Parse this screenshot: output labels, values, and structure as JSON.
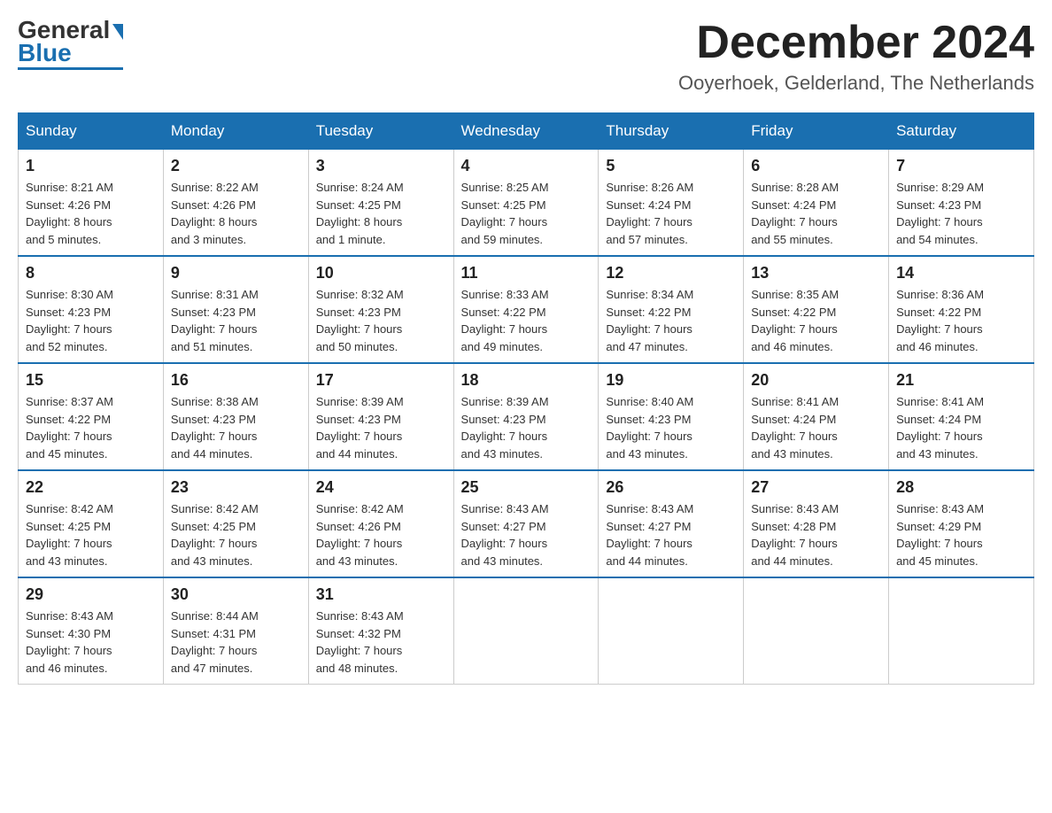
{
  "header": {
    "logo_text_black": "General",
    "logo_text_blue": "Blue",
    "month_title": "December 2024",
    "location": "Ooyerhoek, Gelderland, The Netherlands"
  },
  "days_of_week": [
    "Sunday",
    "Monday",
    "Tuesday",
    "Wednesday",
    "Thursday",
    "Friday",
    "Saturday"
  ],
  "weeks": [
    [
      {
        "day": "1",
        "sunrise": "Sunrise: 8:21 AM",
        "sunset": "Sunset: 4:26 PM",
        "daylight": "Daylight: 8 hours and 5 minutes."
      },
      {
        "day": "2",
        "sunrise": "Sunrise: 8:22 AM",
        "sunset": "Sunset: 4:26 PM",
        "daylight": "Daylight: 8 hours and 3 minutes."
      },
      {
        "day": "3",
        "sunrise": "Sunrise: 8:24 AM",
        "sunset": "Sunset: 4:25 PM",
        "daylight": "Daylight: 8 hours and 1 minute."
      },
      {
        "day": "4",
        "sunrise": "Sunrise: 8:25 AM",
        "sunset": "Sunset: 4:25 PM",
        "daylight": "Daylight: 7 hours and 59 minutes."
      },
      {
        "day": "5",
        "sunrise": "Sunrise: 8:26 AM",
        "sunset": "Sunset: 4:24 PM",
        "daylight": "Daylight: 7 hours and 57 minutes."
      },
      {
        "day": "6",
        "sunrise": "Sunrise: 8:28 AM",
        "sunset": "Sunset: 4:24 PM",
        "daylight": "Daylight: 7 hours and 55 minutes."
      },
      {
        "day": "7",
        "sunrise": "Sunrise: 8:29 AM",
        "sunset": "Sunset: 4:23 PM",
        "daylight": "Daylight: 7 hours and 54 minutes."
      }
    ],
    [
      {
        "day": "8",
        "sunrise": "Sunrise: 8:30 AM",
        "sunset": "Sunset: 4:23 PM",
        "daylight": "Daylight: 7 hours and 52 minutes."
      },
      {
        "day": "9",
        "sunrise": "Sunrise: 8:31 AM",
        "sunset": "Sunset: 4:23 PM",
        "daylight": "Daylight: 7 hours and 51 minutes."
      },
      {
        "day": "10",
        "sunrise": "Sunrise: 8:32 AM",
        "sunset": "Sunset: 4:23 PM",
        "daylight": "Daylight: 7 hours and 50 minutes."
      },
      {
        "day": "11",
        "sunrise": "Sunrise: 8:33 AM",
        "sunset": "Sunset: 4:22 PM",
        "daylight": "Daylight: 7 hours and 49 minutes."
      },
      {
        "day": "12",
        "sunrise": "Sunrise: 8:34 AM",
        "sunset": "Sunset: 4:22 PM",
        "daylight": "Daylight: 7 hours and 47 minutes."
      },
      {
        "day": "13",
        "sunrise": "Sunrise: 8:35 AM",
        "sunset": "Sunset: 4:22 PM",
        "daylight": "Daylight: 7 hours and 46 minutes."
      },
      {
        "day": "14",
        "sunrise": "Sunrise: 8:36 AM",
        "sunset": "Sunset: 4:22 PM",
        "daylight": "Daylight: 7 hours and 46 minutes."
      }
    ],
    [
      {
        "day": "15",
        "sunrise": "Sunrise: 8:37 AM",
        "sunset": "Sunset: 4:22 PM",
        "daylight": "Daylight: 7 hours and 45 minutes."
      },
      {
        "day": "16",
        "sunrise": "Sunrise: 8:38 AM",
        "sunset": "Sunset: 4:23 PM",
        "daylight": "Daylight: 7 hours and 44 minutes."
      },
      {
        "day": "17",
        "sunrise": "Sunrise: 8:39 AM",
        "sunset": "Sunset: 4:23 PM",
        "daylight": "Daylight: 7 hours and 44 minutes."
      },
      {
        "day": "18",
        "sunrise": "Sunrise: 8:39 AM",
        "sunset": "Sunset: 4:23 PM",
        "daylight": "Daylight: 7 hours and 43 minutes."
      },
      {
        "day": "19",
        "sunrise": "Sunrise: 8:40 AM",
        "sunset": "Sunset: 4:23 PM",
        "daylight": "Daylight: 7 hours and 43 minutes."
      },
      {
        "day": "20",
        "sunrise": "Sunrise: 8:41 AM",
        "sunset": "Sunset: 4:24 PM",
        "daylight": "Daylight: 7 hours and 43 minutes."
      },
      {
        "day": "21",
        "sunrise": "Sunrise: 8:41 AM",
        "sunset": "Sunset: 4:24 PM",
        "daylight": "Daylight: 7 hours and 43 minutes."
      }
    ],
    [
      {
        "day": "22",
        "sunrise": "Sunrise: 8:42 AM",
        "sunset": "Sunset: 4:25 PM",
        "daylight": "Daylight: 7 hours and 43 minutes."
      },
      {
        "day": "23",
        "sunrise": "Sunrise: 8:42 AM",
        "sunset": "Sunset: 4:25 PM",
        "daylight": "Daylight: 7 hours and 43 minutes."
      },
      {
        "day": "24",
        "sunrise": "Sunrise: 8:42 AM",
        "sunset": "Sunset: 4:26 PM",
        "daylight": "Daylight: 7 hours and 43 minutes."
      },
      {
        "day": "25",
        "sunrise": "Sunrise: 8:43 AM",
        "sunset": "Sunset: 4:27 PM",
        "daylight": "Daylight: 7 hours and 43 minutes."
      },
      {
        "day": "26",
        "sunrise": "Sunrise: 8:43 AM",
        "sunset": "Sunset: 4:27 PM",
        "daylight": "Daylight: 7 hours and 44 minutes."
      },
      {
        "day": "27",
        "sunrise": "Sunrise: 8:43 AM",
        "sunset": "Sunset: 4:28 PM",
        "daylight": "Daylight: 7 hours and 44 minutes."
      },
      {
        "day": "28",
        "sunrise": "Sunrise: 8:43 AM",
        "sunset": "Sunset: 4:29 PM",
        "daylight": "Daylight: 7 hours and 45 minutes."
      }
    ],
    [
      {
        "day": "29",
        "sunrise": "Sunrise: 8:43 AM",
        "sunset": "Sunset: 4:30 PM",
        "daylight": "Daylight: 7 hours and 46 minutes."
      },
      {
        "day": "30",
        "sunrise": "Sunrise: 8:44 AM",
        "sunset": "Sunset: 4:31 PM",
        "daylight": "Daylight: 7 hours and 47 minutes."
      },
      {
        "day": "31",
        "sunrise": "Sunrise: 8:43 AM",
        "sunset": "Sunset: 4:32 PM",
        "daylight": "Daylight: 7 hours and 48 minutes."
      },
      null,
      null,
      null,
      null
    ]
  ]
}
